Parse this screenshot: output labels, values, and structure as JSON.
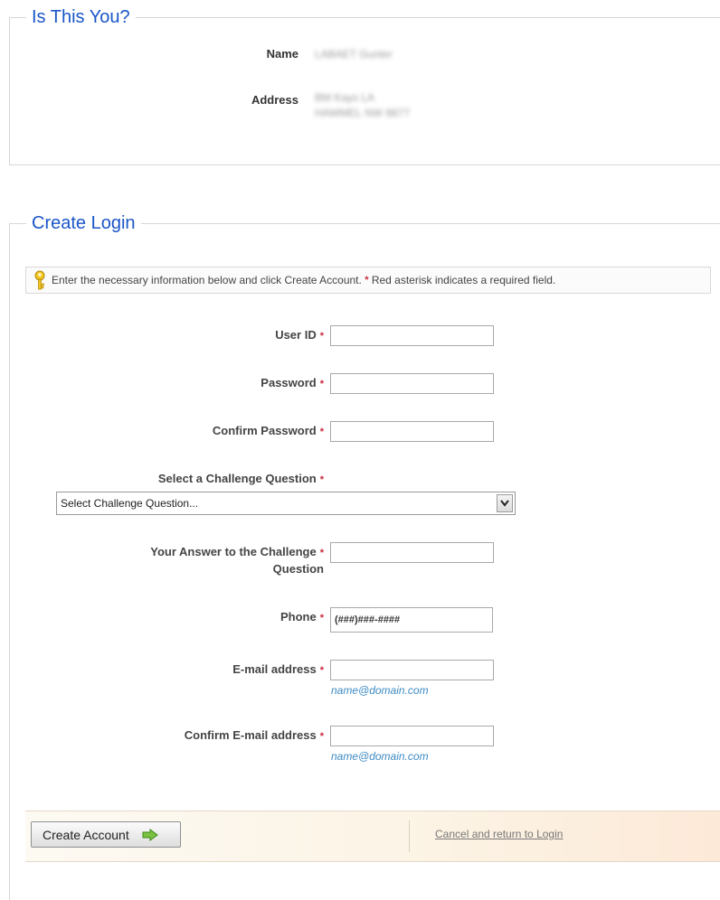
{
  "identity": {
    "legend": "Is This You?",
    "name_label": "Name",
    "name_value": "LABAET Gunter",
    "address_label": "Address",
    "address_line1": "BM Kays LA",
    "address_line2": "HAWMEL NW 8877"
  },
  "create_login": {
    "legend": "Create Login",
    "instructions": "Enter the necessary information below and click Create Account.",
    "required_note": "Red asterisk indicates a required field.",
    "required_marker": "*",
    "fields": {
      "user_id": {
        "label": "User ID",
        "value": ""
      },
      "password": {
        "label": "Password",
        "value": ""
      },
      "confirm_password": {
        "label": "Confirm Password",
        "value": ""
      },
      "challenge_question": {
        "label": "Select a Challenge Question",
        "selected": "Select Challenge Question..."
      },
      "challenge_answer": {
        "label_line1": "Your Answer to the Challenge",
        "label_line2": "Question",
        "value": ""
      },
      "phone": {
        "label": "Phone",
        "value": "(###)###-####"
      },
      "email": {
        "label": "E-mail address",
        "value": "",
        "hint": "name@domain.com"
      },
      "confirm_email": {
        "label": "Confirm E-mail address",
        "value": "",
        "hint": "name@domain.com"
      }
    }
  },
  "footer": {
    "create_button": "Create Account",
    "cancel_link": "Cancel and return to Login"
  },
  "colors": {
    "legend": "#1a56c8",
    "required": "#c8283a",
    "hint": "#3d8bc4"
  }
}
